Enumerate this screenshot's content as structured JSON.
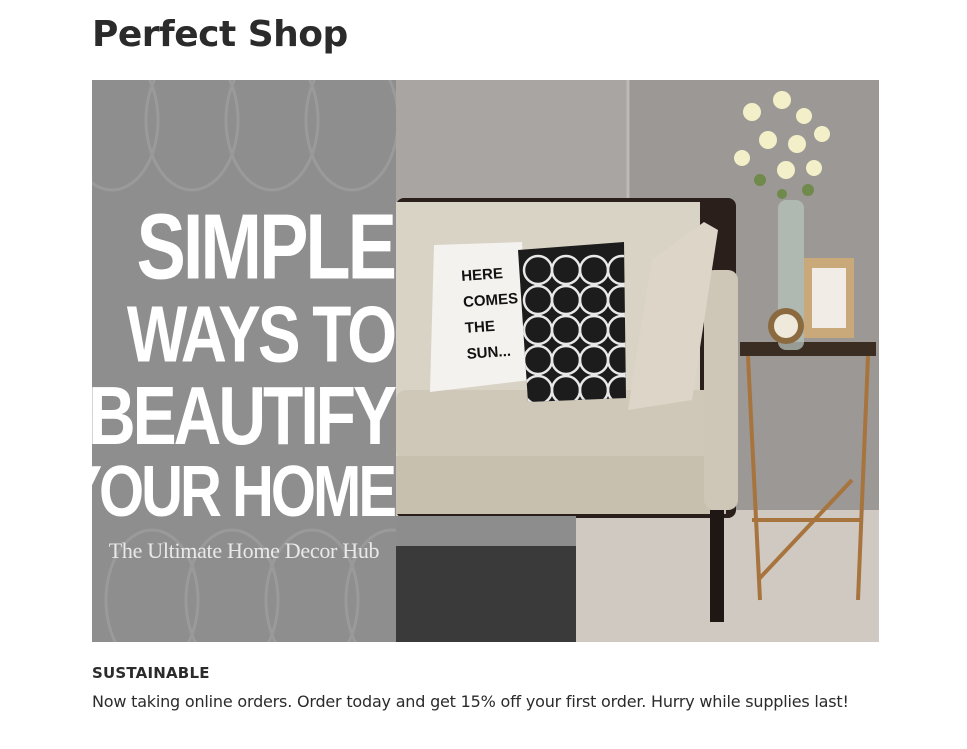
{
  "shop": {
    "title": "Perfect Shop"
  },
  "hero": {
    "headline_lines": [
      "SIMPLE",
      "WAYS TO",
      "BEAUTIFY",
      "YOUR HOME"
    ],
    "tagline": "The Ultimate Home Decor Hub",
    "pillow_lines": [
      "HERE",
      "COMES",
      "THE",
      "SUN..."
    ],
    "colors": {
      "panel": "#8f8f8f",
      "wall": "#a9a6a4",
      "sofa": "#d9d3c6"
    }
  },
  "feature": {
    "heading": "SUSTAINABLE",
    "description": "Now taking online orders. Order today and get 15% off your first order. Hurry while supplies last!"
  }
}
